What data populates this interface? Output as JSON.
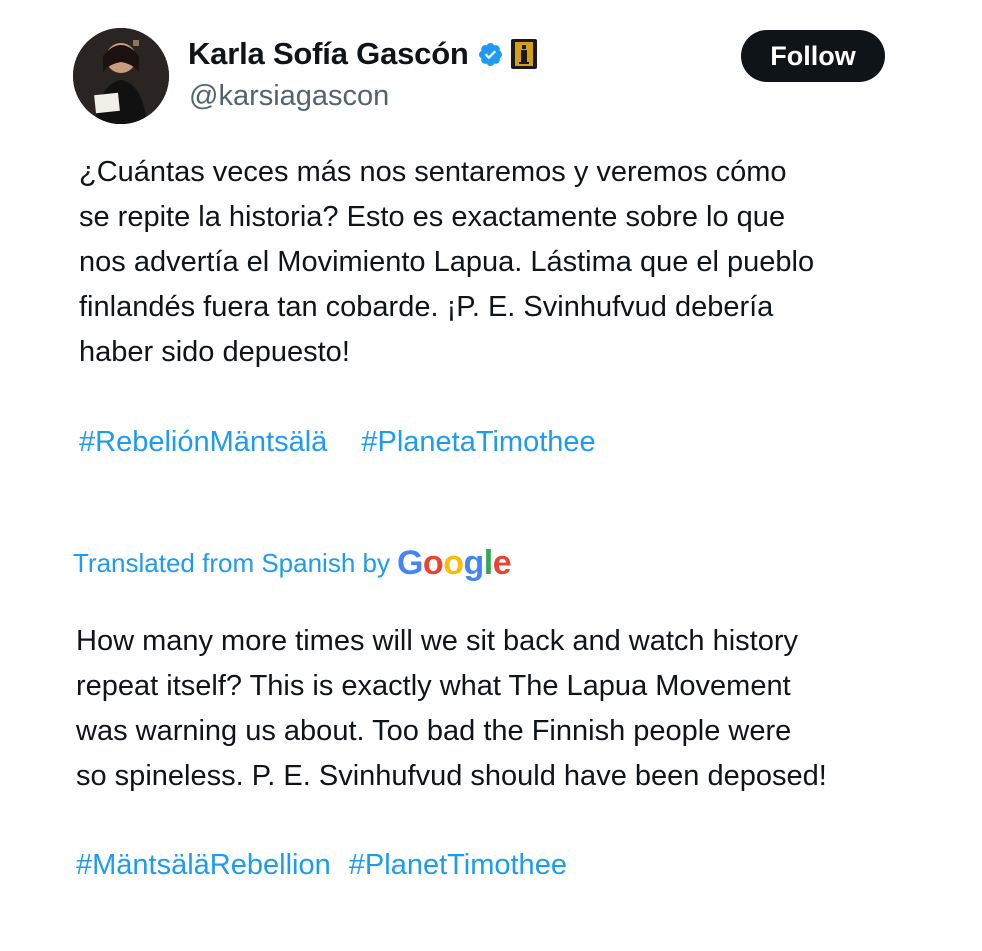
{
  "user": {
    "display_name": "Karla Sofía Gascón",
    "handle": "@karsiagascon",
    "verified": true,
    "avatar_icon": "profile-photo"
  },
  "follow_button": {
    "label": "Follow"
  },
  "tweet": {
    "lines": [
      "¿Cuántas veces más nos sentaremos y veremos cómo",
      "se repite la historia? Esto es exactamente sobre lo que",
      "nos advertía el Movimiento Lapua. Lástima que el pueblo",
      "finlandés fuera tan cobarde. ¡P. E. Svinhufvud debería",
      "haber sido depuesto!"
    ],
    "hashtags": [
      "#RebeliónMäntsälä",
      "#PlanetaTimothee"
    ]
  },
  "translation": {
    "label": "Translated from Spanish by",
    "provider": "Google",
    "lines": [
      "How many more times will we sit back and watch history",
      "repeat itself? This is exactly what The Lapua Movement",
      "was warning us about. Too bad the Finnish people were",
      "so spineless. P. E. Svinhufvud should have been deposed!"
    ],
    "hashtags": [
      "#MäntsäläRebellion",
      "#PlanetTimothee"
    ]
  },
  "colors": {
    "link": "#1d9bf0",
    "text": "#0f1419",
    "secondary": "#536471",
    "button_bg": "#0f1419",
    "verified": "#1d9bf0",
    "affiliation_badge": "#d4a017"
  }
}
